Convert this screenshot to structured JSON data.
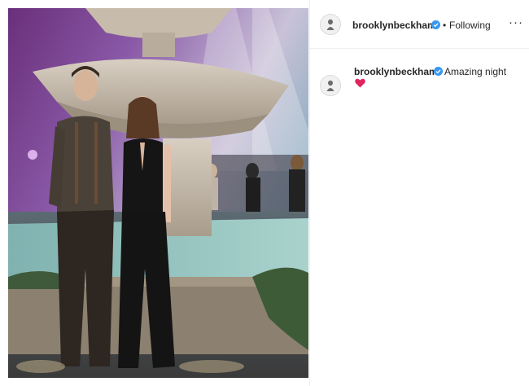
{
  "post": {
    "photo_alt": "",
    "header": {
      "username": "brooklynbeckham",
      "separator": "•",
      "follow_status": "Following",
      "more_label": "···"
    },
    "caption": {
      "username": "brooklynbeckham",
      "text": "Amazing night",
      "emoji": "heart-emoji",
      "emoji_color": "#e0245e"
    }
  },
  "colors": {
    "verified_badge": "#3897f0",
    "text_primary": "#262626",
    "border": "#efefef"
  }
}
